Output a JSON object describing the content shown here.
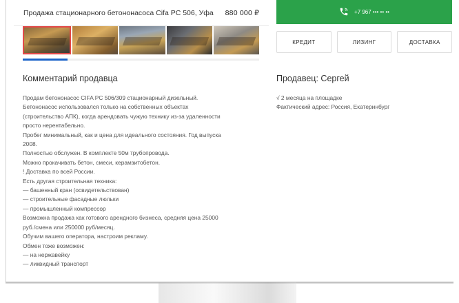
{
  "header": {
    "title": "Продажа стационарного бетононасоса Cifa PC 506, Уфа",
    "price": "880 000 ₽",
    "call_button": {
      "icon": "phone-icon",
      "phone": "+7 967 ••• •• ••"
    }
  },
  "gallery": {
    "photos": [
      "photo-1",
      "photo-2",
      "photo-3",
      "photo-4",
      "photo-5"
    ],
    "selected_index": 0,
    "progress_fraction": 0.19
  },
  "actions": [
    "КРЕДИТ",
    "ЛИЗИНГ",
    "ДОСТАВКА"
  ],
  "comment": {
    "heading": "Комментарий продавца",
    "lines": [
      "Продам бетононасос CIFA PC 506/309 стационарный дизельный.",
      "Бетононасос использовался только на собственных объектах",
      "(строительство АПК), когда арендовать чужую технику из-за удаленности",
      "просто нерентабельно.",
      "Пробег минимальный, как и цена для идеального состояния. Год выпуска",
      "2008.",
      "Полностью обслужен. В комплекте 50м трубопровода.",
      "Можно прокачивать бетон, смеси, керамзитобетон.",
      "! Доставка по всей России.",
      "Есть другая строительная техника:",
      "— башенный кран (освидетельствован)",
      "— строительные фасадные люльки",
      "— промышленный компрессор",
      "Возможна продажа как готового арендного бизнеса, средняя цена 25000",
      "руб./смена или 250000 руб/месяц.",
      "Обучим вашего оператора, настроим рекламу.",
      "Обмен тоже возможен:",
      "— на нержавейку",
      "— ликвидный транспорт"
    ]
  },
  "seller": {
    "heading": "Продавец: Сергей",
    "since": "√ 2 месяца на площадке",
    "address": "Фактический адрес: Россия, Екатеринбург"
  }
}
